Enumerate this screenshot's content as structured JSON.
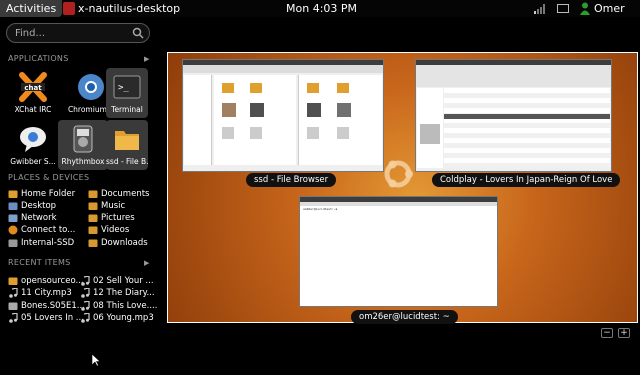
{
  "panel": {
    "activities": "Activities",
    "app_title": "x-nautilus-desktop",
    "clock": "Mon  4:03 PM",
    "user": "Omer"
  },
  "search": {
    "placeholder": "Find..."
  },
  "sections": {
    "applications": "APPLICATIONS",
    "places": "PLACES & DEVICES",
    "recent": "RECENT ITEMS"
  },
  "apps": [
    {
      "label": "XChat IRC",
      "icon": "xchat-icon"
    },
    {
      "label": "Chromium...",
      "icon": "chromium-icon"
    },
    {
      "label": "Terminal",
      "icon": "terminal-icon"
    },
    {
      "label": "Gwibber S...",
      "icon": "gwibber-icon"
    },
    {
      "label": "Rhythmbox",
      "icon": "rhythmbox-icon"
    },
    {
      "label": "ssd - File B...",
      "icon": "folder-icon"
    }
  ],
  "places": [
    {
      "label": "Home Folder",
      "icon": "home-folder-icon"
    },
    {
      "label": "Documents",
      "icon": "folder-icon"
    },
    {
      "label": "Desktop",
      "icon": "desktop-icon"
    },
    {
      "label": "Music",
      "icon": "folder-icon"
    },
    {
      "label": "Network",
      "icon": "network-icon"
    },
    {
      "label": "Pictures",
      "icon": "folder-icon"
    },
    {
      "label": "Connect to...",
      "icon": "connect-icon"
    },
    {
      "label": "Videos",
      "icon": "folder-icon"
    },
    {
      "label": "Internal-SSD",
      "icon": "drive-icon"
    },
    {
      "label": "Downloads",
      "icon": "folder-icon"
    }
  ],
  "recent": [
    {
      "label": "opensourceo...",
      "icon": "document-icon"
    },
    {
      "label": "02 Sell Your ...",
      "icon": "music-note-icon"
    },
    {
      "label": "11 City.mp3",
      "icon": "music-note-icon"
    },
    {
      "label": "12 The Diary...",
      "icon": "music-note-icon"
    },
    {
      "label": "Bones.S05E1...",
      "icon": "video-icon"
    },
    {
      "label": "08 This Love....",
      "icon": "music-note-icon"
    },
    {
      "label": "05 Lovers In ...",
      "icon": "music-note-icon"
    },
    {
      "label": "06 Young.mp3",
      "icon": "music-note-icon"
    }
  ],
  "windows": [
    {
      "label": "ssd - File Browser"
    },
    {
      "label": "Coldplay - Lovers In Japan-Reign Of Love"
    },
    {
      "label": "om26er@lucidtest: ~"
    }
  ],
  "workspace_controls": {
    "remove": "−",
    "add": "+"
  },
  "colors": {
    "accent": "#d97a24",
    "selection": "#3a3a3a",
    "terminal_prompt": "om26er@lucidtest:~$"
  }
}
